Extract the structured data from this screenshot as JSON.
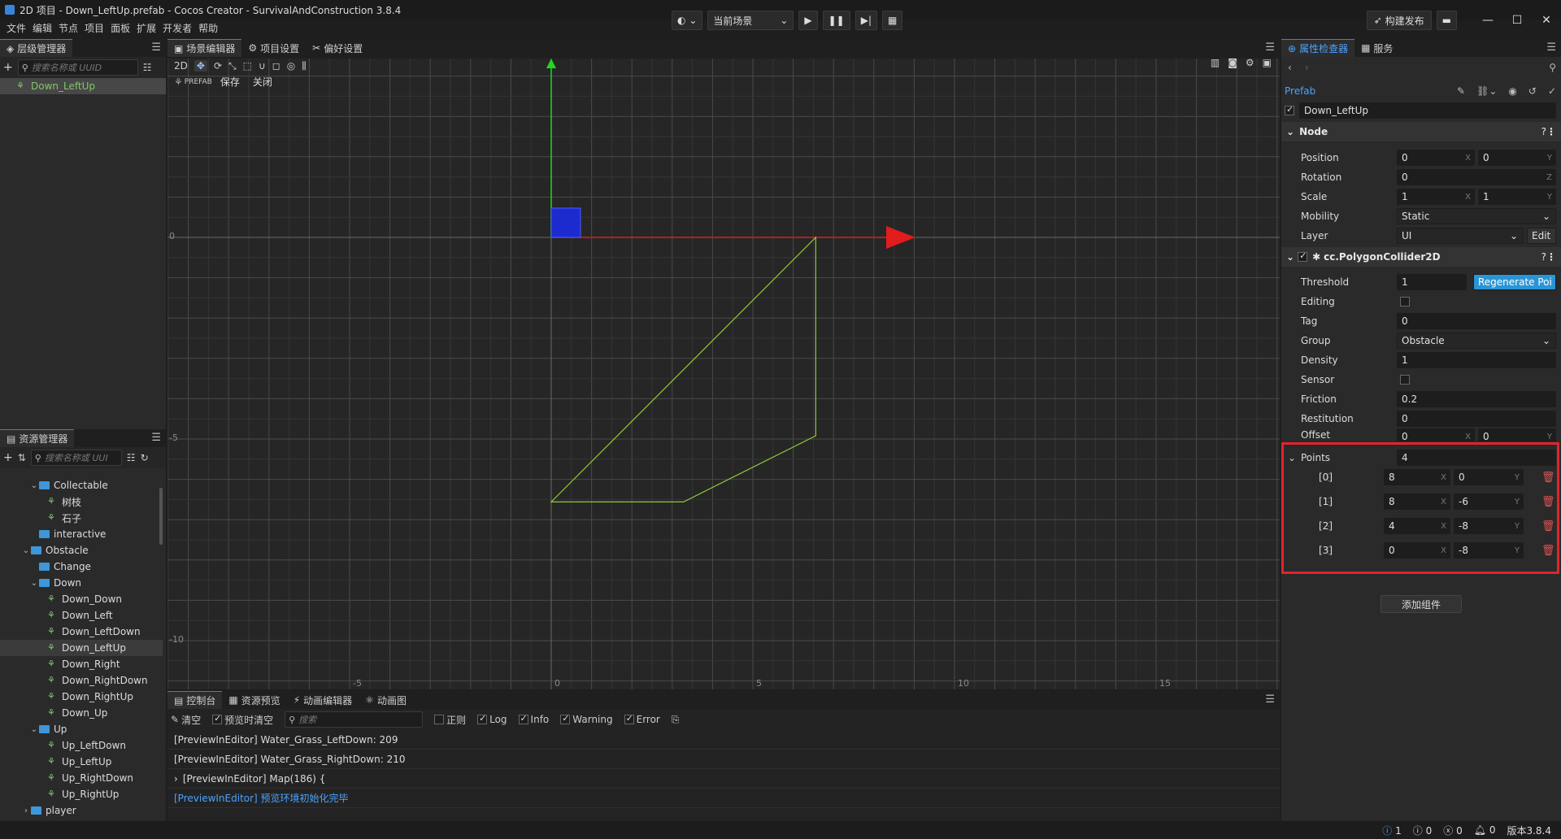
{
  "window": {
    "title": "2D 项目 - Down_LeftUp.prefab - Cocos Creator - SurvivalAndConstruction 3.8.4"
  },
  "menu": [
    "文件",
    "编辑",
    "节点",
    "项目",
    "面板",
    "扩展",
    "开发者",
    "帮助"
  ],
  "toolbar": {
    "scene_select": "当前场景",
    "publish": "构建发布"
  },
  "hierarchy": {
    "tab": "层级管理器",
    "search_placeholder": "搜索名称或 UUID",
    "root_item": "Down_LeftUp"
  },
  "assets": {
    "tab": "资源管理器",
    "search_placeholder": "搜索名称或 UUI",
    "tree": [
      {
        "label": "Collectable",
        "indent": 1,
        "type": "folder",
        "expanded": true
      },
      {
        "label": "树枝",
        "indent": 2,
        "type": "prefab"
      },
      {
        "label": "石子",
        "indent": 2,
        "type": "prefab"
      },
      {
        "label": "interactive",
        "indent": 1,
        "type": "folder"
      },
      {
        "label": "Obstacle",
        "indent": 0,
        "type": "folder",
        "expanded": true
      },
      {
        "label": "Change",
        "indent": 1,
        "type": "folder"
      },
      {
        "label": "Down",
        "indent": 1,
        "type": "folder",
        "expanded": true
      },
      {
        "label": "Down_Down",
        "indent": 2,
        "type": "prefab"
      },
      {
        "label": "Down_Left",
        "indent": 2,
        "type": "prefab"
      },
      {
        "label": "Down_LeftDown",
        "indent": 2,
        "type": "prefab"
      },
      {
        "label": "Down_LeftUp",
        "indent": 2,
        "type": "prefab",
        "selected": true
      },
      {
        "label": "Down_Right",
        "indent": 2,
        "type": "prefab"
      },
      {
        "label": "Down_RightDown",
        "indent": 2,
        "type": "prefab"
      },
      {
        "label": "Down_RightUp",
        "indent": 2,
        "type": "prefab"
      },
      {
        "label": "Down_Up",
        "indent": 2,
        "type": "prefab"
      },
      {
        "label": "Up",
        "indent": 1,
        "type": "folder",
        "expanded": true
      },
      {
        "label": "Up_LeftDown",
        "indent": 2,
        "type": "prefab"
      },
      {
        "label": "Up_LeftUp",
        "indent": 2,
        "type": "prefab"
      },
      {
        "label": "Up_RightDown",
        "indent": 2,
        "type": "prefab"
      },
      {
        "label": "Up_RightUp",
        "indent": 2,
        "type": "prefab"
      },
      {
        "label": "player",
        "indent": 0,
        "type": "folder",
        "collapsed": true
      }
    ]
  },
  "scene": {
    "tabs": [
      "场景编辑器",
      "项目设置",
      "偏好设置"
    ],
    "mode": "2D",
    "prefab_tag": "PREFAB",
    "save": "保存",
    "close": "关闭",
    "axis_labels": {
      "y0": "0",
      "yn5": "-5",
      "yn10": "-10",
      "xn5": "-5",
      "x0": "0",
      "x5": "5",
      "x10": "10",
      "x15": "15"
    }
  },
  "console": {
    "tabs": [
      "控制台",
      "资源预览",
      "动画编辑器",
      "动画图"
    ],
    "clear": "清空",
    "preview_clear": "预览时清空",
    "search_placeholder": "搜索",
    "regex": "正则",
    "filters": [
      "Log",
      "Info",
      "Warning",
      "Error"
    ],
    "logs": [
      "[PreviewInEditor] Water_Grass_LeftDown: 209",
      "[PreviewInEditor] Water_Grass_RightDown: 210",
      "[PreviewInEditor] Map(186) {",
      "[PreviewInEditor] 预览环境初始化完毕"
    ]
  },
  "inspector": {
    "tabs": [
      "属性检查器",
      "服务"
    ],
    "asset_type": "Prefab",
    "node_name": "Down_LeftUp",
    "node_section": "Node",
    "position": {
      "label": "Position",
      "x": "0",
      "y": "0"
    },
    "rotation": {
      "label": "Rotation",
      "z": "0"
    },
    "scale": {
      "label": "Scale",
      "x": "1",
      "y": "1"
    },
    "mobility": {
      "label": "Mobility",
      "value": "Static"
    },
    "layer": {
      "label": "Layer",
      "value": "UI",
      "edit": "Edit"
    },
    "collider_section": "cc.PolygonCollider2D",
    "threshold": {
      "label": "Threshold",
      "value": "1",
      "button": "Regenerate Poi"
    },
    "editing": {
      "label": "Editing"
    },
    "tag": {
      "label": "Tag",
      "value": "0"
    },
    "group": {
      "label": "Group",
      "value": "Obstacle"
    },
    "density": {
      "label": "Density",
      "value": "1"
    },
    "sensor": {
      "label": "Sensor"
    },
    "friction": {
      "label": "Friction",
      "value": "0.2"
    },
    "restitution": {
      "label": "Restitution",
      "value": "0"
    },
    "offset": {
      "label": "Offset",
      "x": "0",
      "y": "0"
    },
    "points": {
      "label": "Points",
      "count": "4",
      "items": [
        {
          "index": "[0]",
          "x": "8",
          "y": "0"
        },
        {
          "index": "[1]",
          "x": "8",
          "y": "-6"
        },
        {
          "index": "[2]",
          "x": "4",
          "y": "-8"
        },
        {
          "index": "[3]",
          "x": "0",
          "y": "-8"
        }
      ]
    },
    "add_component": "添加组件"
  },
  "status": {
    "info": "1",
    "warn": "0",
    "error": "0",
    "notify": "0",
    "version": "版本3.8.4"
  },
  "colors": {
    "highlight_box": "#e0242c",
    "accent_blue": "#2a95d6",
    "collider_green": "#8fc83c"
  }
}
